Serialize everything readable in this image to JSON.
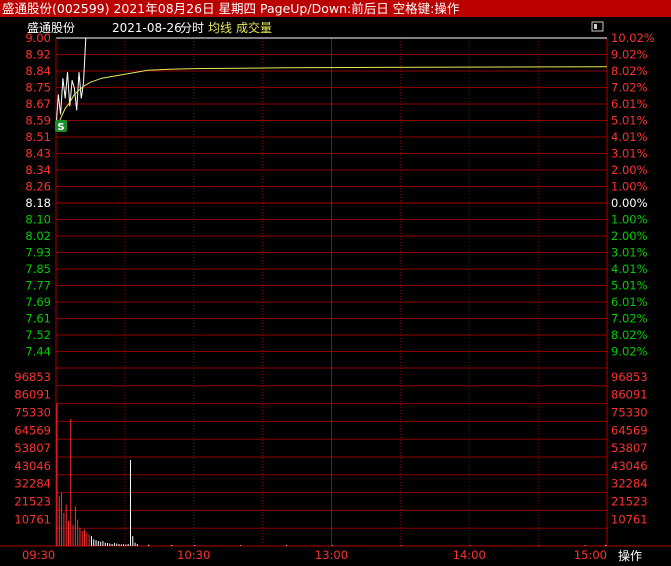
{
  "title_bar": {
    "text": "盛通股份(002599) 2021年08月26日 星期四 PageUp/Down:前后日 空格键:操作"
  },
  "subtitle": {
    "stock": "盛通股份",
    "date": "2021-08-26",
    "mode": "分时",
    "avg_label": "均线",
    "vol_label": "成交量"
  },
  "bottom_button": "操作",
  "colors": {
    "up": "#ff3030",
    "down": "#00cc00",
    "flat": "#ffffff",
    "grid": "#8b0000",
    "price_line": "#ffffff",
    "avg_line": "#e8e85a"
  },
  "chart_data": {
    "type": "line",
    "price_axis": {
      "left_labels": [
        "9.00",
        "8.92",
        "8.84",
        "8.75",
        "8.67",
        "8.59",
        "8.51",
        "8.43",
        "8.34",
        "8.26",
        "8.18",
        "8.10",
        "8.02",
        "7.93",
        "7.85",
        "7.77",
        "7.69",
        "7.61",
        "7.52",
        "7.44"
      ],
      "right_labels": [
        "10.02%",
        "9.02%",
        "8.02%",
        "7.02%",
        "6.01%",
        "5.01%",
        "4.01%",
        "3.01%",
        "2.00%",
        "1.00%",
        "0.00%",
        "1.00%",
        "2.00%",
        "3.01%",
        "4.01%",
        "5.01%",
        "6.01%",
        "7.02%",
        "8.02%",
        "9.02%"
      ],
      "prev_close": 8.18,
      "ylim": [
        7.36,
        9.0
      ]
    },
    "volume_axis": {
      "labels": [
        "96853",
        "86091",
        "75330",
        "64569",
        "53807",
        "43046",
        "32284",
        "21523",
        "10761"
      ],
      "ylim": [
        0,
        107614
      ]
    },
    "x_labels": [
      "09:30",
      "10:30",
      "13:00",
      "14:00",
      "15:00"
    ],
    "marker": "S",
    "price_series": [
      [
        0,
        8.55
      ],
      [
        1,
        8.72
      ],
      [
        2,
        8.62
      ],
      [
        3,
        8.8
      ],
      [
        4,
        8.7
      ],
      [
        5,
        8.83
      ],
      [
        6,
        8.66
      ],
      [
        7,
        8.79
      ],
      [
        8,
        8.75
      ],
      [
        9,
        8.64
      ],
      [
        10,
        8.83
      ],
      [
        11,
        8.7
      ],
      [
        12,
        8.78
      ],
      [
        13,
        9.0
      ],
      [
        14,
        9.0
      ],
      [
        240,
        9.0
      ]
    ],
    "avg_series": [
      [
        0,
        8.55
      ],
      [
        2,
        8.6
      ],
      [
        4,
        8.65
      ],
      [
        6,
        8.68
      ],
      [
        8,
        8.72
      ],
      [
        10,
        8.74
      ],
      [
        12,
        8.76
      ],
      [
        15,
        8.78
      ],
      [
        20,
        8.8
      ],
      [
        30,
        8.82
      ],
      [
        40,
        8.84
      ],
      [
        50,
        8.845
      ],
      [
        60,
        8.848
      ],
      [
        100,
        8.852
      ],
      [
        160,
        8.855
      ],
      [
        240,
        8.857
      ]
    ],
    "volume_series": [
      [
        0,
        86091,
        "up"
      ],
      [
        1,
        30000,
        "up"
      ],
      [
        2,
        32284,
        "up"
      ],
      [
        3,
        20000,
        "up"
      ],
      [
        4,
        25000,
        "up"
      ],
      [
        5,
        15000,
        "up"
      ],
      [
        6,
        77000,
        "up"
      ],
      [
        7,
        13000,
        "up"
      ],
      [
        8,
        24000,
        "up"
      ],
      [
        9,
        16000,
        "up"
      ],
      [
        10,
        11000,
        "up"
      ],
      [
        11,
        9000,
        "up"
      ],
      [
        12,
        10000,
        "up"
      ],
      [
        13,
        8000,
        "up"
      ],
      [
        14,
        7000,
        "up"
      ],
      [
        15,
        6000,
        "flat"
      ],
      [
        16,
        4000,
        "flat"
      ],
      [
        17,
        3500,
        "flat"
      ],
      [
        18,
        3000,
        "flat"
      ],
      [
        19,
        2500,
        "flat"
      ],
      [
        20,
        3000,
        "flat"
      ],
      [
        21,
        2000,
        "flat"
      ],
      [
        22,
        1800,
        "flat"
      ],
      [
        23,
        1500,
        "flat"
      ],
      [
        24,
        1200,
        "flat"
      ],
      [
        25,
        1800,
        "flat"
      ],
      [
        26,
        1500,
        "flat"
      ],
      [
        27,
        1200,
        "flat"
      ],
      [
        28,
        1000,
        "flat"
      ],
      [
        29,
        1100,
        "flat"
      ],
      [
        30,
        900,
        "flat"
      ],
      [
        31,
        1200,
        "flat"
      ],
      [
        32,
        52000,
        "flat"
      ],
      [
        33,
        6000,
        "flat"
      ],
      [
        34,
        2000,
        "flat"
      ],
      [
        35,
        1200,
        "flat"
      ],
      [
        40,
        800,
        "flat"
      ],
      [
        50,
        600,
        "flat"
      ],
      [
        60,
        500,
        "flat"
      ],
      [
        80,
        400,
        "flat"
      ],
      [
        100,
        500,
        "flat"
      ],
      [
        120,
        400,
        "flat"
      ],
      [
        150,
        350,
        "flat"
      ],
      [
        180,
        350,
        "flat"
      ],
      [
        210,
        300,
        "flat"
      ],
      [
        230,
        400,
        "flat"
      ],
      [
        239,
        600,
        "flat"
      ]
    ]
  }
}
